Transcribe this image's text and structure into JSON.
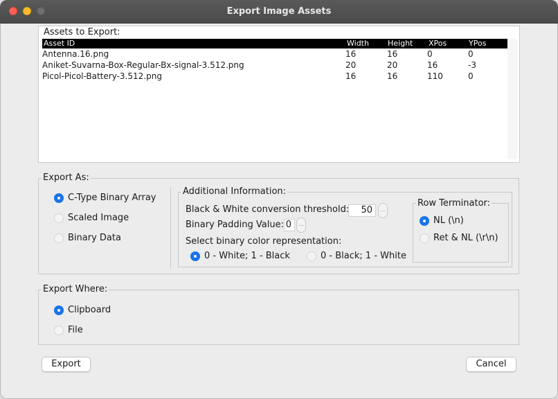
{
  "window": {
    "title": "Export Image Assets"
  },
  "assets": {
    "legend": "Assets to Export:",
    "columns": [
      "Asset ID",
      "Width",
      "Height",
      "XPos",
      "YPos"
    ],
    "rows": [
      [
        "Antenna.16.png",
        "16",
        "16",
        "0",
        "0"
      ],
      [
        "Aniket-Suvarna-Box-Regular-Bx-signal-3.512.png",
        "20",
        "20",
        "16",
        "-3"
      ],
      [
        "Picol-Picol-Battery-3.512.png",
        "16",
        "16",
        "110",
        "0"
      ]
    ]
  },
  "export_as": {
    "legend": "Export As:",
    "options": [
      {
        "label": "C-Type Binary Array",
        "selected": true
      },
      {
        "label": "Scaled Image",
        "selected": false
      },
      {
        "label": "Binary Data",
        "selected": false
      }
    ]
  },
  "additional": {
    "legend": "Additional Information:",
    "threshold_label": "Black & White conversion threshold:",
    "threshold_value": "50",
    "padding_label": "Binary Padding Value:",
    "padding_value": "0",
    "color_label": "Select binary color representation:",
    "color_options": [
      {
        "label": "0 - White; 1 - Black",
        "selected": true
      },
      {
        "label": "0 - Black; 1 - White",
        "selected": false
      }
    ]
  },
  "row_terminator": {
    "legend": "Row Terminator:",
    "options": [
      {
        "label": "NL (\\n)",
        "selected": true
      },
      {
        "label": "Ret & NL (\\r\\n)",
        "selected": false
      }
    ]
  },
  "export_where": {
    "legend": "Export Where:",
    "options": [
      {
        "label": "Clipboard",
        "selected": true
      },
      {
        "label": "File",
        "selected": false
      }
    ]
  },
  "buttons": {
    "export": "Export",
    "cancel": "Cancel"
  }
}
